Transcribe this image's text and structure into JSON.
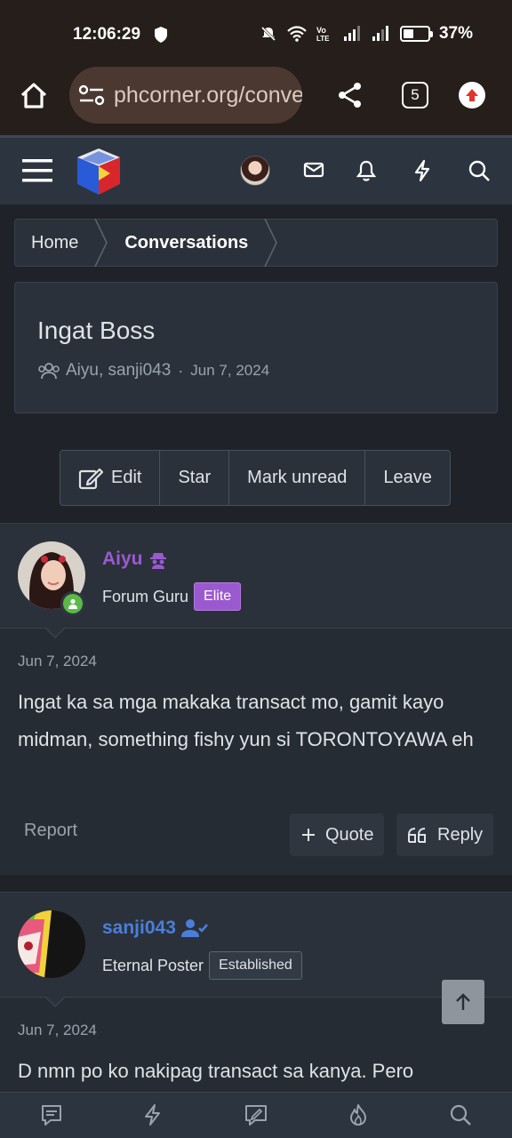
{
  "status_bar": {
    "time": "12:06:29",
    "battery_percent": "37%",
    "battery_level": 0.37
  },
  "browser": {
    "url": "phcorner.org/conve",
    "tab_count": "5"
  },
  "breadcrumb": {
    "items": [
      "Home",
      "Conversations"
    ]
  },
  "conversation": {
    "title": "Ingat Boss",
    "participants": "Aiyu, sanji043",
    "separator": "·",
    "date": "Jun 7, 2024"
  },
  "actions": {
    "edit": "Edit",
    "star": "Star",
    "mark_unread": "Mark unread",
    "leave": "Leave"
  },
  "messages": [
    {
      "username": "Aiyu",
      "username_color": "#9b59d0",
      "rank": "Forum Guru",
      "badge": "Elite",
      "date": "Jun 7, 2024",
      "body": "Ingat ka sa mga makaka transact mo, gamit kayo midman, something fishy yun si TORONTOYAWA eh",
      "report": "Report",
      "quote": "Quote",
      "reply": "Reply"
    },
    {
      "username": "sanji043",
      "username_color": "#4a7fd9",
      "rank": "Eternal Poster",
      "badge": "Established",
      "date": "Jun 7, 2024",
      "body": "D nmn po ko nakipag transact sa kanya. Pero"
    }
  ],
  "colors": {
    "accent_purple": "#9b59d0",
    "accent_blue": "#4a7fd9",
    "online_green": "#5bb94a"
  }
}
